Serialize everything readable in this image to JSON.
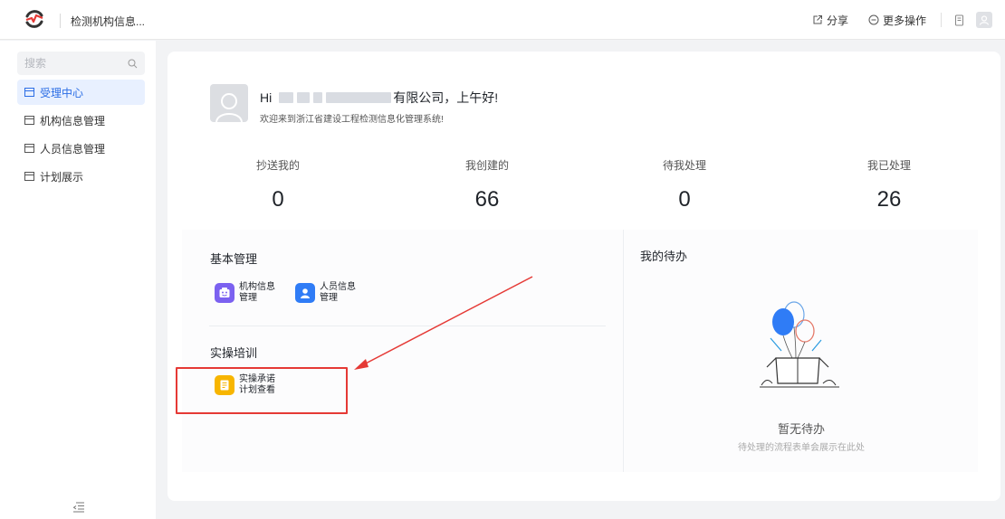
{
  "header": {
    "app_title": "检测机构信息...",
    "share_label": "分享",
    "more_label": "更多操作"
  },
  "sidebar": {
    "search_placeholder": "搜索",
    "items": [
      {
        "label": "受理中心",
        "active": true
      },
      {
        "label": "机构信息管理",
        "active": false
      },
      {
        "label": "人员信息管理",
        "active": false
      },
      {
        "label": "计划展示",
        "active": false
      }
    ]
  },
  "greeting": {
    "hi": "Hi",
    "company_suffix": "有限公司，上午好!",
    "welcome": "欢迎来到浙江省建设工程检测信息化管理系统!"
  },
  "stats": [
    {
      "label": "抄送我的",
      "value": "0"
    },
    {
      "label": "我创建的",
      "value": "66"
    },
    {
      "label": "待我处理",
      "value": "0"
    },
    {
      "label": "我已处理",
      "value": "26"
    }
  ],
  "basic": {
    "title": "基本管理",
    "apps": [
      {
        "label": "机构信息管理",
        "color": "#7b61f0"
      },
      {
        "label": "人员信息管理",
        "color": "#2f7cf6"
      }
    ]
  },
  "training": {
    "title": "实操培训",
    "apps": [
      {
        "label": "实操承诺计划查看",
        "color": "#f7b500"
      }
    ]
  },
  "todo": {
    "title": "我的待办",
    "empty_title": "暂无待办",
    "empty_sub": "待处理的流程表单会展示在此处"
  },
  "colors": {
    "accent": "#2b6de5",
    "annotation": "#e53935"
  }
}
